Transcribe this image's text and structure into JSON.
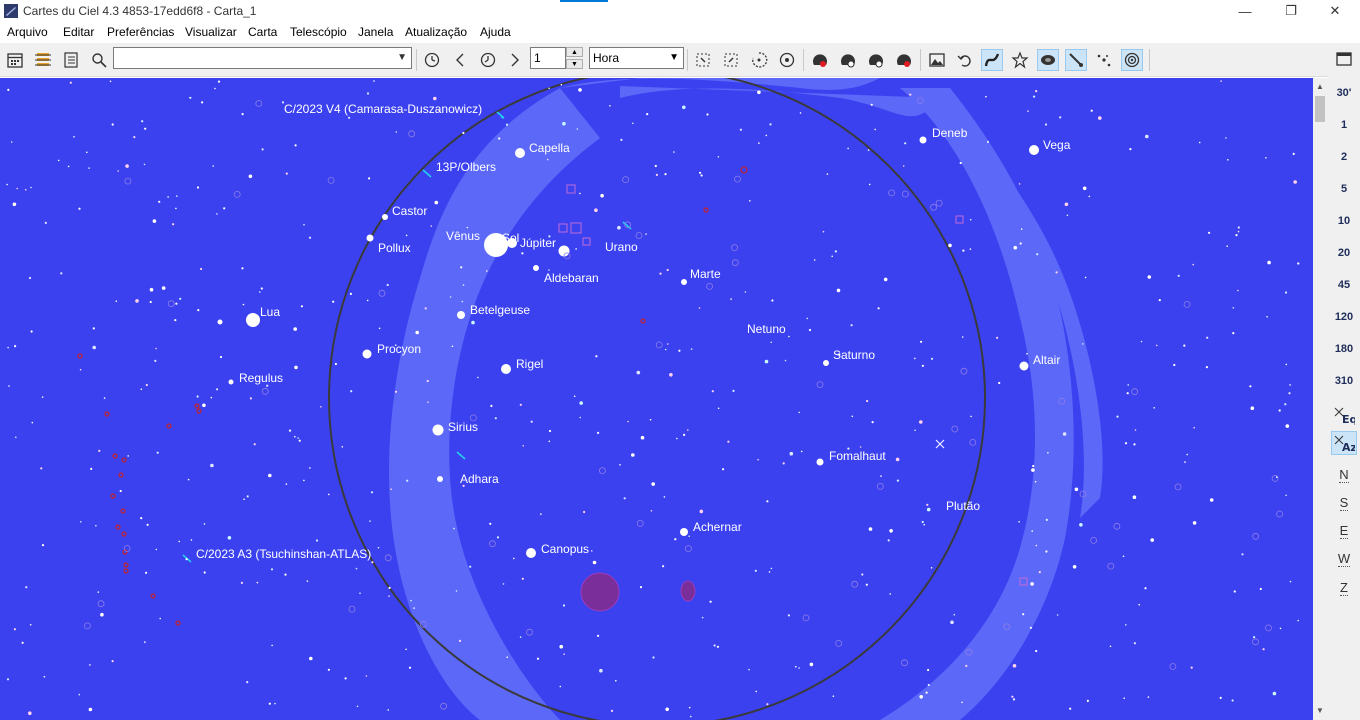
{
  "window": {
    "title": "Cartes du Ciel 4.3 4853-17edd6f8 - Carta_1",
    "minimize_glyph": "—",
    "maximize_glyph": "❐",
    "close_glyph": "✕"
  },
  "menu": [
    "Arquivo",
    "Editar",
    "Preferências",
    "Visualizar",
    "Carta",
    "Telescópio",
    "Janela",
    "Atualização",
    "Ajuda"
  ],
  "toolbar": {
    "search_value": "",
    "time_step_value": "1",
    "time_unit": "Hora",
    "icons": [
      "calendar-icon",
      "layers-icon",
      "list-icon",
      "search-icon",
      "clock-icon",
      "step-back-icon",
      "now-icon",
      "step-forward-icon",
      "zoom-area-icon",
      "zoom-fit-icon",
      "rotate-icon",
      "target-icon",
      "planet-a-icon",
      "planet-b-icon",
      "planet-c-icon",
      "planet-d-icon",
      "image-icon",
      "undo-icon",
      "constellation-lines-icon",
      "star-icon",
      "galaxy-icon",
      "comet-icon",
      "sparkle-icon",
      "target-ring-icon"
    ]
  },
  "right_panel": {
    "fov_levels": [
      "30'",
      "1",
      "2",
      "5",
      "10",
      "20",
      "45",
      "120",
      "180",
      "310"
    ],
    "eq_label": "Eq",
    "az_label": "Az",
    "compass": [
      "N",
      "S",
      "E",
      "W",
      "Z"
    ]
  },
  "colors": {
    "sky": "#3b41ef",
    "milky_way": "#5c68f8",
    "horizon_circle": "#3a3a3a",
    "labels": "#ffffff",
    "comet_marker": "#22d3ee",
    "variable_marker": "#c0212b",
    "nebula_marker": "#b13cc8"
  },
  "labels": {
    "comet_c2023v4": "C/2023 V4 (Camarasa-Duszanowicz)",
    "comet_13p": "13P/Olbers",
    "comet_c2023a3": "C/2023 A3 (Tsuchinshan-ATLAS)",
    "capella": "Capella",
    "castor": "Castor",
    "pollux": "Pollux",
    "venus": "Vênus",
    "sol": "Sol",
    "jupiter": "Júpiter",
    "urano": "Urano",
    "aldebaran": "Aldebaran",
    "marte": "Marte",
    "betelgeuse": "Betelgeuse",
    "netuno": "Netuno",
    "lua": "Lua",
    "procyon": "Procyon",
    "saturno": "Saturno",
    "regulus": "Regulus",
    "rigel": "Rigel",
    "sirius": "Sirius",
    "fomalhaut": "Fomalhaut",
    "adhara": "Adhara",
    "achernar": "Achernar",
    "canopus": "Canopus",
    "deneb": "Deneb",
    "vega": "Vega",
    "altair": "Altair",
    "plutao": "Plutão"
  }
}
